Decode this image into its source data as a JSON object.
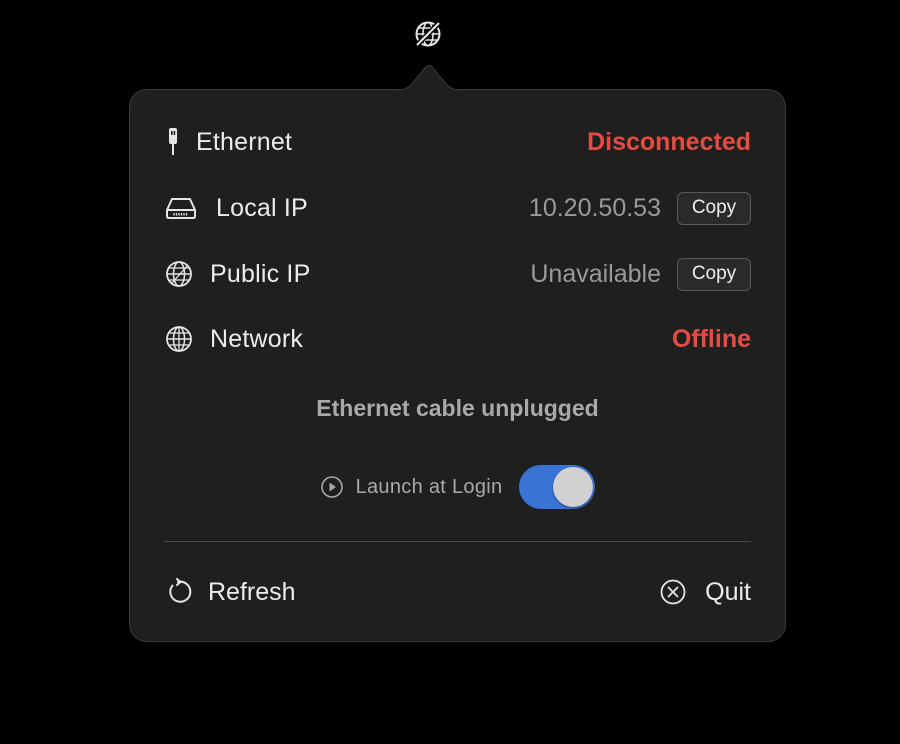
{
  "menubar": {
    "icon": "globe-slash-icon"
  },
  "rows": {
    "ethernet": {
      "icon": "ethernet-plug-icon",
      "label": "Ethernet",
      "value": "Disconnected",
      "value_color": "#e74c42"
    },
    "local_ip": {
      "icon": "network-drive-icon",
      "label": "Local IP",
      "value": "10.20.50.53",
      "copy_label": "Copy"
    },
    "public_ip": {
      "icon": "globe-grid-icon",
      "label": "Public IP",
      "value": "Unavailable",
      "copy_label": "Copy"
    },
    "network": {
      "icon": "globe-icon",
      "label": "Network",
      "value": "Offline",
      "value_color": "#e74c42"
    }
  },
  "hint": "Ethernet cable unplugged",
  "launch_at_login": {
    "icon": "play-circle-icon",
    "label": "Launch at Login",
    "enabled": true,
    "toggle_color": "#3a73d6"
  },
  "footer": {
    "refresh_label": "Refresh",
    "refresh_icon": "refresh-icon",
    "quit_label": "Quit",
    "quit_icon": "close-circle-icon"
  }
}
